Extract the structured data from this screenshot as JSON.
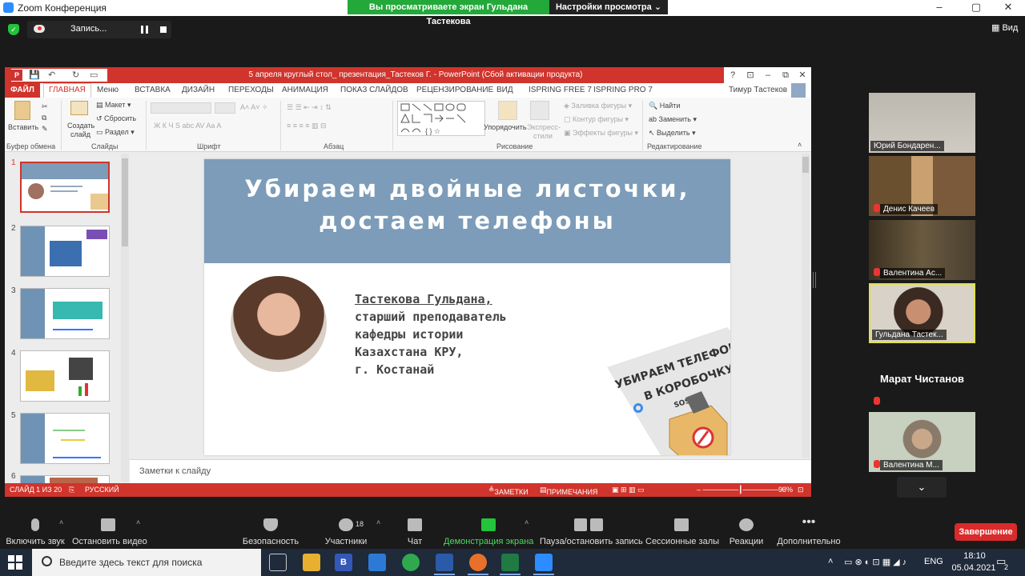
{
  "zoom": {
    "window_title": "Zoom Конференция",
    "viewing_banner": "Вы просматриваете экран Гульдана Тастекова",
    "view_settings": "Настройки просмотра ⌄",
    "recording_label": "Запись...",
    "view_label": "Вид"
  },
  "ppt": {
    "title": "5 апреля круглый стол_ презентация_Тастеков Г. -  PowerPoint (Сбой активации продукта)",
    "tabs": [
      "Меню",
      "ВСТАВКА",
      "ДИЗАЙН",
      "ПЕРЕХОДЫ",
      "АНИМАЦИЯ",
      "ПОКАЗ СЛАЙДОВ",
      "РЕЦЕНЗИРОВАНИЕ",
      "ВИД",
      "ISPRING FREE 7",
      "ISPRING PRO 7"
    ],
    "file_tab": "ФАЙЛ",
    "active_tab": "ГЛАВНАЯ",
    "user": "Тимур Тастеков",
    "ribbon": {
      "paste": "Вставить",
      "new_slide_1": "Создать",
      "new_slide_2": "слайд",
      "layout": "Макет",
      "reset": "Сбросить",
      "section": "Раздел",
      "arrange": "Упорядочить",
      "styles_1": "Экспресс-",
      "styles_2": "стили",
      "fill": "Заливка фигуры",
      "outline": "Контур фигуры",
      "effects": "Эффекты фигуры",
      "find": "Найти",
      "replace": "Заменить",
      "select": "Выделить",
      "groups": {
        "clipboard": "Буфер обмена",
        "slides": "Слайды",
        "font": "Шрифт",
        "paragraph": "Абзац",
        "drawing": "Рисование",
        "editing": "Редактирование"
      }
    },
    "slide_numbers": [
      "1",
      "2",
      "3",
      "4",
      "5",
      "6"
    ],
    "slide": {
      "title_line1": "Убираем двойные листочки,",
      "title_line2": "достаем телефоны",
      "name": "Тастекова Гульдана,",
      "bio": [
        "старший преподаватель",
        "кафедры истории",
        "Казахстана КРУ,",
        "г. Костанай"
      ],
      "sticker_line1": "УБИРАЕМ ТЕЛЕФОНЫ",
      "sticker_line2": "В КОРОБОЧКУ",
      "sticker_sos": "SOS"
    },
    "notes_placeholder": "Заметки к слайду",
    "status": {
      "slide_of": "СЛАЙД 1 ИЗ 20",
      "language": "РУССКИЙ",
      "notes": "ЗАМЕТКИ",
      "comments": "ПРИМЕЧАНИЯ",
      "zoom": "93%"
    }
  },
  "participants": [
    {
      "name": "Юрий Бондарен...",
      "muted": false
    },
    {
      "name": "Денис Качеев",
      "muted": true
    },
    {
      "name": "Валентина Ас...",
      "muted": true
    },
    {
      "name": "Гульдана Тастек...",
      "muted": false,
      "active": true
    },
    {
      "name": "Марат Чистанов",
      "muted": true
    },
    {
      "name": "Валентина М...",
      "muted": true
    }
  ],
  "toolbar": {
    "unmute": "Включить звук",
    "stop_video": "Остановить видео",
    "security": "Безопасность",
    "participants": "Участники",
    "participants_count": "18",
    "chat": "Чат",
    "share": "Демонстрация экрана",
    "pause_rec": "Пауза/остановить запись",
    "breakout": "Сессионные залы",
    "reactions": "Реакции",
    "more": "Дополнительно",
    "end": "Завершение"
  },
  "taskbar": {
    "search_placeholder": "Введите здесь текст для поиска",
    "lang": "ENG",
    "time": "18:10",
    "date": "05.04.2021",
    "notif_count": "2"
  },
  "colors": {
    "ppt_red": "#d0342c",
    "slide_header": "#7c9cb9",
    "zoom_green": "#23a83a",
    "end_red": "#d92b2b"
  }
}
